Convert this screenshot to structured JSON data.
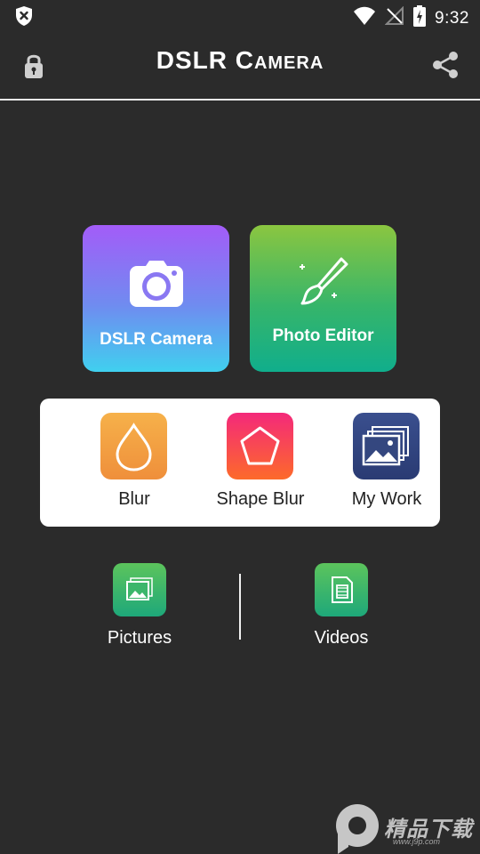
{
  "status_bar": {
    "time": "9:32",
    "icons": [
      "shield-x-icon",
      "wifi-icon",
      "no-signal-icon",
      "battery-charging-icon"
    ]
  },
  "app_bar": {
    "title": "DSLR Camera",
    "left_icon": "lock-icon",
    "right_icon": "share-icon"
  },
  "tiles": [
    {
      "label": "DSLR Camera",
      "icon": "camera-icon",
      "colors": [
        "#a35cf8",
        "#40d0ef"
      ]
    },
    {
      "label": "Photo Editor",
      "icon": "brush-icon",
      "colors": [
        "#8bc640",
        "#10ae8c"
      ]
    }
  ],
  "tools": [
    {
      "label": "Blur",
      "icon": "drop-icon",
      "color": "#f3a343"
    },
    {
      "label": "Shape Blur",
      "icon": "pentagon-icon",
      "color": "#f8384f"
    },
    {
      "label": "My Work",
      "icon": "gallery-icon",
      "color": "#34477f"
    }
  ],
  "bottom": [
    {
      "label": "Pictures",
      "icon": "pictures-icon"
    },
    {
      "label": "Videos",
      "icon": "video-file-icon"
    }
  ],
  "watermark": {
    "text": "精品下载",
    "url": "www.j9p.com"
  }
}
